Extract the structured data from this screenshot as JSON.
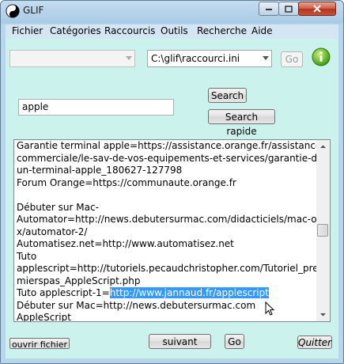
{
  "window": {
    "title": "GLIF"
  },
  "menu": [
    "Fichier",
    "Catégories",
    "Raccourcis",
    "Outils",
    "Recherche",
    "Aide"
  ],
  "top": {
    "category_combo_value": "",
    "file_combo_value": "C:\\glif\\raccourci.ini",
    "go_label": "Go"
  },
  "search": {
    "query": "apple",
    "search_label": "Search",
    "quick_search_label": "Search rapide"
  },
  "results": {
    "lines": [
      "Garantie terminal apple=https://assistance.orange.fr/assistance-",
      "commerciale/le-sav-de-vos-equipements-et-services/garantie-d-",
      "un-terminal-apple_180627-127798",
      "Forum Orange=https://communaute.orange.fr",
      "",
      "Débuter sur Mac-",
      "Automator=http://news.debutersurmac.com/didacticiels/mac-os-",
      "x/automator-2/",
      "Automatisez.net=http://www.automatisez.net",
      "Tuto",
      "applescript=http://tutoriels.pecaudchristopher.com/Tutoriel_pre",
      "mierspas_AppleScript.php"
    ],
    "selected_line_prefix": "Tuto applescript-1=",
    "selected_text": "http://www.jannaud.fr/applescript",
    "lines_after": [
      "Débuter sur Mac=http://news.debutersurmac.com",
      "AppleScript"
    ]
  },
  "bottom": {
    "open_file_label": "ouvrir fichier",
    "next_label": "suivant",
    "go_label": "Go",
    "quit_label": "Quitter"
  },
  "colors": {
    "client_bg": "#ccf2ee",
    "selection": "#3399ff"
  }
}
